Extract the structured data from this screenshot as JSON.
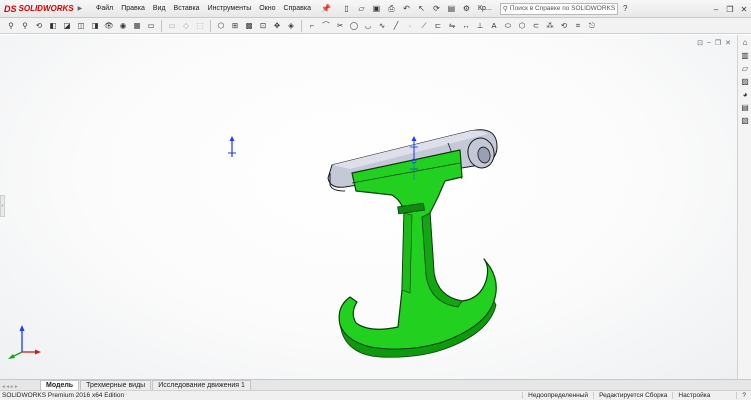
{
  "app": {
    "logo_ds": "DS",
    "logo_text": "SOLIDWORKS"
  },
  "menu": [
    {
      "name": "menu-file",
      "label": "Файл"
    },
    {
      "name": "menu-edit",
      "label": "Правка"
    },
    {
      "name": "menu-view",
      "label": "Вид"
    },
    {
      "name": "menu-insert",
      "label": "Вставка"
    },
    {
      "name": "menu-tools",
      "label": "Инструменты"
    },
    {
      "name": "menu-window",
      "label": "Окно"
    },
    {
      "name": "menu-help",
      "label": "Справка"
    }
  ],
  "toolbar": {
    "kr_label": "Кр..."
  },
  "search": {
    "placeholder": "Поиск в Справке по SOLIDWORKS"
  },
  "tabs": {
    "model": "Модель",
    "views3d": "Трехмерные виды",
    "motion": "Исследование движения 1"
  },
  "status": {
    "edition": "SOLIDWORKS Premium 2016 x64 Edition",
    "defined": "Недоопределенный",
    "editing": "Редактируется Сборка",
    "settings": "Настройка"
  },
  "colors": {
    "part_green": "#22d11f",
    "part_green_dark": "#0c8f0c",
    "part_top": "#c9ccd8",
    "accent": "#d00000"
  }
}
